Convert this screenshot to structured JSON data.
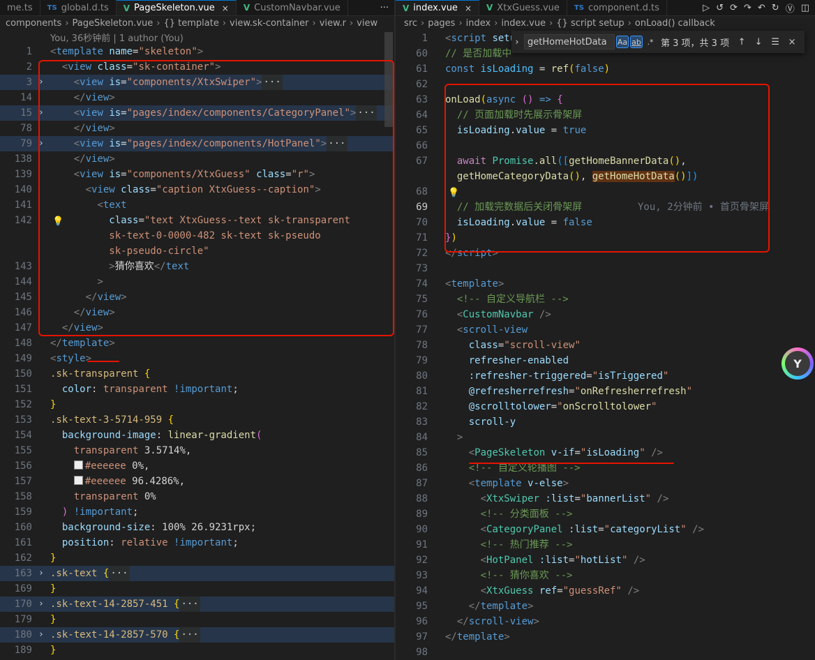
{
  "left": {
    "tabs": [
      {
        "icon": "",
        "label": "me.ts",
        "active": false
      },
      {
        "icon": "TS",
        "label": "global.d.ts",
        "active": false
      },
      {
        "icon": "V",
        "label": "PageSkeleton.vue",
        "active": true,
        "close": "×"
      },
      {
        "icon": "V",
        "label": "CustomNavbar.vue",
        "active": false
      }
    ],
    "more": "···",
    "breadcrumb": [
      "components",
      "PageSkeleton.vue",
      "{} template",
      "view.sk-container",
      "view.r",
      "view"
    ],
    "blame": "You, 36秒钟前 | 1 author (You)",
    "lines": [
      {
        "n": "1",
        "html": "<span class='p'>&lt;</span><span class='t'>template</span> <span class='a'>name</span><span class='w'>=</span><span class='s'>\"skeleton\"</span><span class='p'>&gt;</span>"
      },
      {
        "n": "2",
        "html": "  <span class='p'>&lt;</span><span class='t'>view</span> <span class='a'>class</span><span class='w'>=</span><span class='s'>\"sk-container\"</span><span class='p'>&gt;</span>"
      },
      {
        "n": "3",
        "fold": true,
        "hl": true,
        "html": "    <span class='p'>&lt;</span><span class='t'>view</span> <span class='a'>is</span><span class='w'>=</span><span class='s'>\"components/XtxSwiper\"</span><span class='p'>&gt;</span><span class='fold'>···</span>"
      },
      {
        "n": "14",
        "html": "    <span class='p'>&lt;/</span><span class='t'>view</span><span class='p'>&gt;</span>"
      },
      {
        "n": "15",
        "fold": true,
        "hl": true,
        "html": "    <span class='p'>&lt;</span><span class='t'>view</span> <span class='a'>is</span><span class='w'>=</span><span class='s'>\"pages/index/components/CategoryPanel\"</span><span class='p'>&gt;</span><span class='fold'>···</span>"
      },
      {
        "n": "78",
        "html": "    <span class='p'>&lt;/</span><span class='t'>view</span><span class='p'>&gt;</span>"
      },
      {
        "n": "79",
        "fold": true,
        "hl": true,
        "html": "    <span class='p'>&lt;</span><span class='t'>view</span> <span class='a'>is</span><span class='w'>=</span><span class='s'>\"pages/index/components/HotPanel\"</span><span class='p'>&gt;</span><span class='fold'>···</span>"
      },
      {
        "n": "138",
        "html": "    <span class='p'>&lt;/</span><span class='t'>view</span><span class='p'>&gt;</span>"
      },
      {
        "n": "139",
        "html": "    <span class='p'>&lt;</span><span class='t'>view</span> <span class='a'>is</span><span class='w'>=</span><span class='s'>\"components/XtxGuess\"</span> <span class='a'>class</span><span class='w'>=</span><span class='s'>\"r\"</span><span class='p'>&gt;</span>"
      },
      {
        "n": "140",
        "html": "      <span class='p'>&lt;</span><span class='t'>view</span> <span class='a'>class</span><span class='w'>=</span><span class='s'>\"caption XtxGuess--caption\"</span><span class='p'>&gt;</span>"
      },
      {
        "n": "141",
        "html": "        <span class='p'>&lt;</span><span class='t'>text</span>"
      },
      {
        "n": "142",
        "bulb": true,
        "html": "          <span class='a'>class</span><span class='w'>=</span><span class='s'>\"text XtxGuess--text sk-transparent</span>"
      },
      {
        "n": "",
        "html": "<span class='s'>          sk-text-0-0000-482 sk-text sk-pseudo</span>"
      },
      {
        "n": "",
        "html": "<span class='s'>          sk-pseudo-circle\"</span>"
      },
      {
        "n": "143",
        "html": "          <span class='p'>&gt;</span><span class='w'>猜你喜欢</span><span class='p'>&lt;/</span><span class='t'>text</span>"
      },
      {
        "n": "144",
        "html": "        <span class='p'>&gt;</span>"
      },
      {
        "n": "145",
        "html": "      <span class='p'>&lt;/</span><span class='t'>view</span><span class='p'>&gt;</span>"
      },
      {
        "n": "146",
        "html": "    <span class='p'>&lt;/</span><span class='t'>view</span><span class='p'>&gt;</span>"
      },
      {
        "n": "147",
        "html": "  <span class='p'>&lt;/</span><span class='t'>view</span><span class='p'>&gt;</span>"
      },
      {
        "n": "148",
        "html": "<span class='p'>&lt;/</span><span class='t'>template</span><span class='p'>&gt;</span>"
      },
      {
        "n": "149",
        "html": "<span class='p'>&lt;</span><span class='t'>style</span><span class='p'>&gt;</span>"
      },
      {
        "n": "150",
        "html": "<span class='sel'>.sk-transparent</span> <span class='y'>{</span>"
      },
      {
        "n": "151",
        "html": "  <span class='a'>color</span><span class='w'>: </span><span class='s'>transparent</span> <span class='k'>!important</span><span class='w'>;</span>"
      },
      {
        "n": "152",
        "html": "<span class='y'>}</span>"
      },
      {
        "n": "153",
        "html": "<span class='sel'>.sk-text-3-5714-959</span> <span class='y'>{</span>"
      },
      {
        "n": "154",
        "html": "  <span class='a'>background-image</span><span class='w'>: </span><span class='f'>linear-gradient</span><span class='pk'>(</span>"
      },
      {
        "n": "155",
        "html": "    <span class='s'>transparent</span> <span class='w'>3.5714%,</span>"
      },
      {
        "n": "156",
        "html": "    <span class='sw'></span><span class='s'>#eeeeee</span> <span class='w'>0%,</span>"
      },
      {
        "n": "157",
        "html": "    <span class='sw'></span><span class='s'>#eeeeee</span> <span class='w'>96.4286%,</span>"
      },
      {
        "n": "158",
        "html": "    <span class='s'>transparent</span> <span class='w'>0%</span>"
      },
      {
        "n": "159",
        "html": "  <span class='pk'>)</span> <span class='k'>!important</span><span class='w'>;</span>"
      },
      {
        "n": "160",
        "html": "  <span class='a'>background-size</span><span class='w'>: 100% 26.9231rpx;</span>"
      },
      {
        "n": "161",
        "html": "  <span class='a'>position</span><span class='w'>: </span><span class='s'>relative</span> <span class='k'>!important</span><span class='w'>;</span>"
      },
      {
        "n": "162",
        "html": "<span class='y'>}</span>"
      },
      {
        "n": "163",
        "fold": true,
        "hl": true,
        "html": "<span class='sel'>.sk-text</span> <span class='y'>{</span><span class='fold'>···</span>"
      },
      {
        "n": "169",
        "html": "<span class='y'>}</span>"
      },
      {
        "n": "170",
        "fold": true,
        "hl": true,
        "html": "<span class='sel'>.sk-text-14-2857-451</span> <span class='y'>{</span><span class='fold'>···</span>"
      },
      {
        "n": "179",
        "html": "<span class='y'>}</span>"
      },
      {
        "n": "180",
        "fold": true,
        "hl": true,
        "html": "<span class='sel'>.sk-text-14-2857-570</span> <span class='y'>{</span><span class='fold'>···</span>"
      },
      {
        "n": "189",
        "html": "<span class='y'>}</span>"
      }
    ]
  },
  "right": {
    "tabs": [
      {
        "icon": "V",
        "label": "index.vue",
        "active": true,
        "close": "×"
      },
      {
        "icon": "V",
        "label": "XtxGuess.vue",
        "active": false
      },
      {
        "icon": "TS",
        "label": "component.d.ts",
        "active": false
      }
    ],
    "toolbar_icons": [
      "▷",
      "↺",
      "⟳",
      "↷",
      "↶",
      "↻",
      "Ⓥ",
      "◫"
    ],
    "breadcrumb": [
      "src",
      "pages",
      "index",
      "index.vue",
      "{} script setup",
      "onLoad() callback"
    ],
    "find": {
      "value": "getHomeHotData",
      "opt_case": "Aa",
      "opt_word": "ab",
      "opt_regex": ".*",
      "count": "第 3 项，共 3 项",
      "prev": "↑",
      "next": "↓",
      "sel": "☰",
      "close": "×",
      "toggle": "›"
    },
    "lines": [
      {
        "n": "1",
        "html": "<span class='p'>&lt;</span><span class='t'>script</span> <span class='a'>setup</span>"
      },
      {
        "n": "60",
        "html": "<span class='c'>// 是否加载中</span>"
      },
      {
        "n": "61",
        "html": "<span class='k'>const</span> <span class='var'>isLoading</span> <span class='w'>= </span><span class='f'>ref</span><span class='y'>(</span><span class='k'>false</span><span class='y'>)</span>"
      },
      {
        "n": "62",
        "html": ""
      },
      {
        "n": "63",
        "html": "<span class='f'>onLoad</span><span class='y'>(</span><span class='k'>async</span> <span class='pk'>()</span> <span class='k'>=&gt;</span> <span class='pk'>{</span>"
      },
      {
        "n": "64",
        "html": "  <span class='c'>// 页面加载时先展示骨架屏</span>"
      },
      {
        "n": "65",
        "html": "  <span class='a'>isLoading</span><span class='w'>.</span><span class='a'>value</span> <span class='w'>= </span><span class='k'>true</span>"
      },
      {
        "n": "66",
        "html": ""
      },
      {
        "n": "67",
        "html": "  <span class='ctrl'>await</span> <span class='v'>Promise</span><span class='w'>.</span><span class='f'>all</span><span class='bl'>([</span><span class='f'>getHomeBannerData</span><span class='y'>()</span><span class='w'>,</span>"
      },
      {
        "n": "",
        "html": "  <span class='f'>getHomeCategoryData</span><span class='y'>()</span><span class='w'>, </span><span class='f' style='background:#613214'>getHomeHotData</span><span class='y'>()</span><span class='bl'>])</span>"
      },
      {
        "n": "68",
        "bulb": true,
        "html": ""
      },
      {
        "n": "69",
        "cur": true,
        "html": "  <span class='c'>// 加载完数据后关闭骨架屏</span>"
      },
      {
        "n": "70",
        "html": "  <span class='a'>isLoading</span><span class='w'>.</span><span class='a'>value</span> <span class='w'>= </span><span class='k'>false</span>"
      },
      {
        "n": "71",
        "html": "<span class='pk'>}</span><span class='y'>)</span>"
      },
      {
        "n": "72",
        "html": "<span class='p'>&lt;/</span><span class='t'>script</span><span class='p'>&gt;</span>"
      },
      {
        "n": "73",
        "html": ""
      },
      {
        "n": "74",
        "html": "<span class='p'>&lt;</span><span class='t'>template</span><span class='p'>&gt;</span>"
      },
      {
        "n": "75",
        "html": "  <span class='c'>&lt;!-- 自定义导航栏 --&gt;</span>"
      },
      {
        "n": "76",
        "html": "  <span class='p'>&lt;</span><span class='v'>CustomNavbar</span> <span class='p'>/&gt;</span>"
      },
      {
        "n": "77",
        "html": "  <span class='p'>&lt;</span><span class='t'>scroll-view</span>"
      },
      {
        "n": "78",
        "html": "    <span class='a'>class</span><span class='w'>=</span><span class='s'>\"scroll-view\"</span>"
      },
      {
        "n": "79",
        "html": "    <span class='a'>refresher-enabled</span>"
      },
      {
        "n": "80",
        "html": "    <span class='a'>:refresher-triggered</span><span class='w'>=</span><span class='s'>\"</span><span class='a'>isTriggered</span><span class='s'>\"</span>"
      },
      {
        "n": "81",
        "html": "    <span class='a'>@refresherrefresh</span><span class='w'>=</span><span class='s'>\"</span><span class='f'>onRefresherrefresh</span><span class='s'>\"</span>"
      },
      {
        "n": "82",
        "html": "    <span class='a'>@scrolltolower</span><span class='w'>=</span><span class='s'>\"</span><span class='f'>onScrolltolower</span><span class='s'>\"</span>"
      },
      {
        "n": "83",
        "html": "    <span class='a'>scroll-y</span>"
      },
      {
        "n": "84",
        "html": "  <span class='p'>&gt;</span>"
      },
      {
        "n": "85",
        "html": "    <span class='p'>&lt;</span><span class='v'>PageSkeleton</span> <span class='a'>v-if</span><span class='w'>=</span><span class='s'>\"</span><span class='a'>isLoading</span><span class='s'>\"</span> <span class='p'>/&gt;</span>"
      },
      {
        "n": "86",
        "html": "    <span class='c'>&lt;!-- 自定义轮播图 --&gt;</span>"
      },
      {
        "n": "87",
        "html": "    <span class='p'>&lt;</span><span class='t'>template</span> <span class='a'>v-else</span><span class='p'>&gt;</span>"
      },
      {
        "n": "88",
        "html": "      <span class='p'>&lt;</span><span class='v'>XtxSwiper</span> <span class='a'>:list</span><span class='w'>=</span><span class='s'>\"</span><span class='a'>bannerList</span><span class='s'>\"</span> <span class='p'>/&gt;</span>"
      },
      {
        "n": "89",
        "html": "      <span class='c'>&lt;!-- 分类面板 --&gt;</span>"
      },
      {
        "n": "90",
        "html": "      <span class='p'>&lt;</span><span class='v'>CategoryPanel</span> <span class='a'>:list</span><span class='w'>=</span><span class='s'>\"</span><span class='a'>categoryList</span><span class='s'>\"</span> <span class='p'>/&gt;</span>"
      },
      {
        "n": "91",
        "html": "      <span class='c'>&lt;!-- 热门推荐 --&gt;</span>"
      },
      {
        "n": "92",
        "html": "      <span class='p'>&lt;</span><span class='v'>HotPanel</span> <span class='a'>:list</span><span class='w'>=</span><span class='s'>\"</span><span class='a'>hotList</span><span class='s'>\"</span> <span class='p'>/&gt;</span>"
      },
      {
        "n": "93",
        "html": "      <span class='c'>&lt;!-- 猜你喜欢 --&gt;</span>"
      },
      {
        "n": "94",
        "html": "      <span class='p'>&lt;</span><span class='v'>XtxGuess</span> <span class='a'>ref</span><span class='w'>=</span><span class='s'>\"guessRef\"</span> <span class='p'>/&gt;</span>"
      },
      {
        "n": "95",
        "html": "    <span class='p'>&lt;/</span><span class='t'>template</span><span class='p'>&gt;</span>"
      },
      {
        "n": "96",
        "html": "  <span class='p'>&lt;/</span><span class='t'>scroll-view</span><span class='p'>&gt;</span>"
      },
      {
        "n": "97",
        "html": "<span class='p'>&lt;/</span><span class='t'>template</span><span class='p'>&gt;</span>"
      },
      {
        "n": "98",
        "html": ""
      }
    ],
    "ghost_blame": "You, 2分钟前 • 首页骨架屏"
  },
  "colors": {
    "annotation": "#e51400",
    "accent": "#0078d4"
  }
}
